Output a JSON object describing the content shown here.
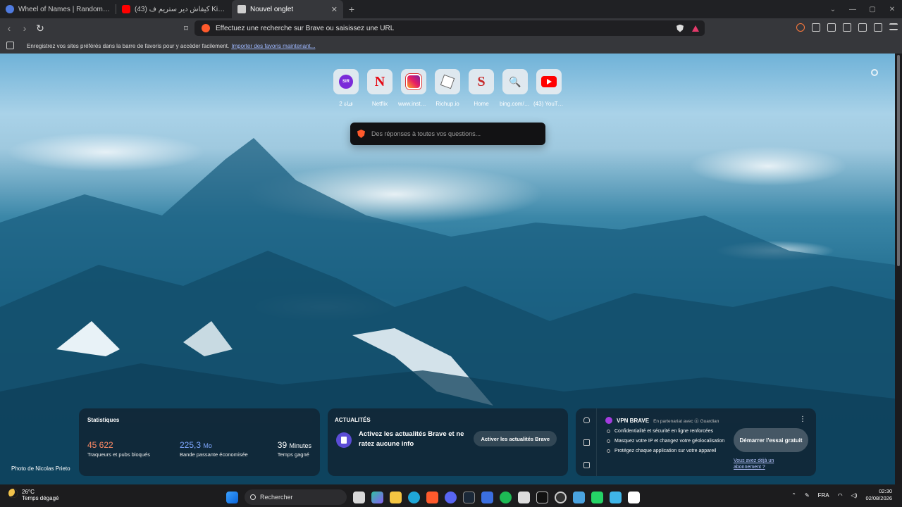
{
  "tabs": [
    {
      "title": "Wheel of Names | Random name picker",
      "favicon_color": "#4f7be0"
    },
    {
      "title": "(43) كيفاش دير ستريم ف Kick | كل ما تحتاجه",
      "favicon_color": "#ff0000"
    },
    {
      "title": "Nouvel onglet",
      "favicon_color": "#cfcfcf",
      "active": true
    }
  ],
  "omnibox": {
    "placeholder": "Effectuez une recherche sur Brave ou saisissez une URL"
  },
  "bookmarks_bar": {
    "message": "Enregistrez vos sites préférés dans la barre de favoris pour y accéder facilement.",
    "link": "Importer des favoris maintenant..."
  },
  "shortcuts": [
    {
      "label": "2 قناة",
      "icon": "sir-icon"
    },
    {
      "label": "Netflix",
      "icon": "netflix-icon",
      "glyph": "N"
    },
    {
      "label": "www.instagram.com",
      "icon": "instagram-icon"
    },
    {
      "label": "Richup.io",
      "icon": "dice-icon"
    },
    {
      "label": "Home",
      "icon": "s-logo-icon",
      "glyph": "S"
    },
    {
      "label": "bing.com/c...",
      "icon": "bing-search-icon",
      "glyph": "🔍"
    },
    {
      "label": "(43) YouTube",
      "icon": "youtube-icon"
    }
  ],
  "ask": {
    "placeholder": "Des réponses à toutes vos questions..."
  },
  "photo_credit": "Photo de Nicolas Prieto",
  "stats": {
    "title": "Statistiques",
    "trackers": {
      "value": "45 622",
      "desc": "Traqueurs et pubs bloqués",
      "color": "#ff8a65"
    },
    "bandwidth": {
      "value": "225,3",
      "unit": "Mo",
      "desc": "Bande passante économisée",
      "color": "#7fa8ff"
    },
    "time": {
      "value": "39",
      "unit": "Minutes",
      "desc": "Temps gagné",
      "color": "#ffffff"
    }
  },
  "news": {
    "title": "ACTUALITÉS",
    "message": "Activez les actualités Brave et ne ratez aucune info",
    "button": "Activer les actualités Brave"
  },
  "vpn": {
    "title": "VPN BRAVE",
    "partner": "En partenariat avec ⓖ Guardian",
    "features": [
      "Confidentialité et sécurité en ligne renforcées",
      "Masquez votre IP et changez votre géolocalisation",
      "Protégez chaque application sur votre appareil"
    ],
    "cta": "Démarrer l'essai gratuit",
    "already": "Vous avez déjà un abonnement ?"
  },
  "taskbar": {
    "weather_temp": "26°C",
    "weather_desc": "Temps dégagé",
    "search_label": "Rechercher",
    "lang": "FRA",
    "time": "02:30",
    "date": "02/08/2026"
  }
}
